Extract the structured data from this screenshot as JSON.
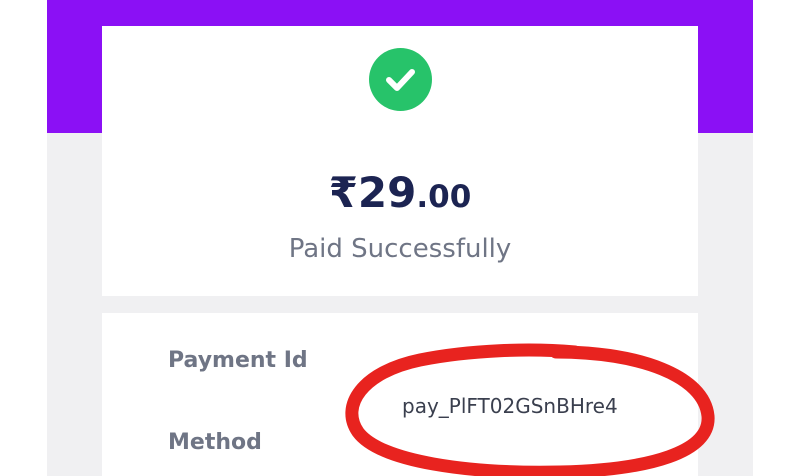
{
  "payment": {
    "currency_symbol": "₹",
    "amount_whole": "29",
    "amount_decimals": ".00",
    "status": "Paid Successfully"
  },
  "details": {
    "payment_id_label": "Payment Id",
    "payment_id_value": "pay_PlFT02GSnBHre4",
    "method_label": "Method"
  },
  "colors": {
    "header_band": "#8b10f5",
    "success_badge": "#27c36a",
    "amount_text": "#1c2452",
    "highlight_ink": "#e8231f"
  },
  "icons": {
    "success": "checkmark-icon"
  }
}
